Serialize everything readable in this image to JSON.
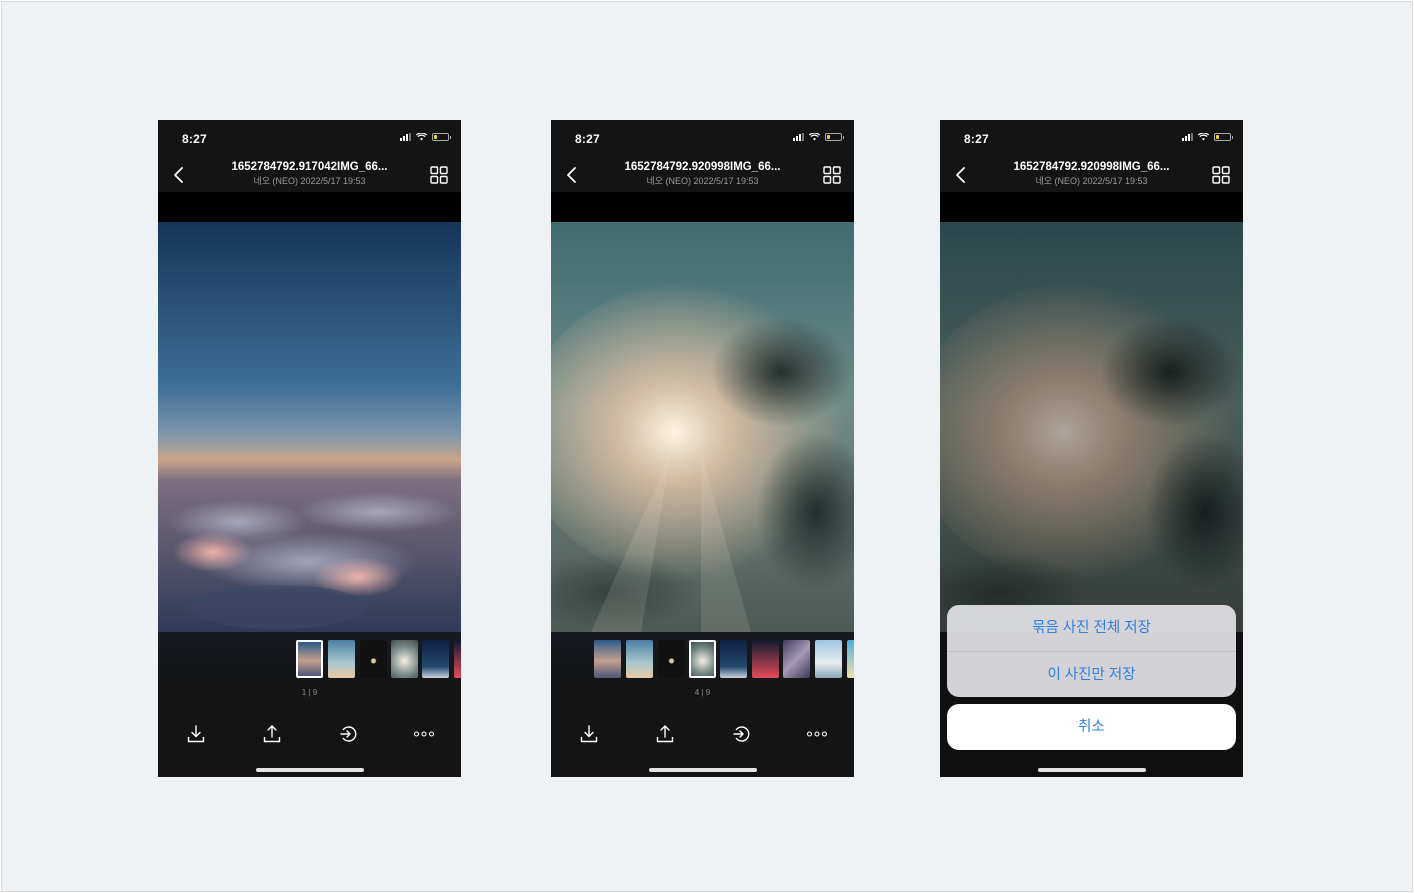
{
  "screens": [
    {
      "id": "screen-1",
      "status_time": "8:27",
      "battery_level": 0.2,
      "title": "1652784792.917042IMG_66...",
      "subtitle": "네오 (NEO) 2022/5/17 19:53",
      "photo_scene": "sunset-above-clouds",
      "thumbnails_count_visible": 6,
      "selected_index": 0,
      "counter": "1 | 9",
      "toolbar": [
        "download-icon",
        "share-icon",
        "forward-icon",
        "more-icon"
      ]
    },
    {
      "id": "screen-2",
      "status_time": "8:27",
      "battery_level": 0.2,
      "title": "1652784792.920998IMG_66...",
      "subtitle": "네오 (NEO) 2022/5/17 19:53",
      "photo_scene": "sun-rays-through-clouds",
      "thumbnails_count_visible": 9,
      "selected_index": 3,
      "counter": "4 | 9",
      "toolbar": [
        "download-icon",
        "share-icon",
        "forward-icon",
        "more-icon"
      ]
    },
    {
      "id": "screen-3",
      "status_time": "8:27",
      "battery_level": 0.2,
      "title": "1652784792.920998IMG_66...",
      "subtitle": "네오 (NEO) 2022/5/17 19:53",
      "photo_scene": "sun-rays-through-clouds-dimmed",
      "action_sheet": {
        "options": [
          "묶음 사진 전체 저장",
          "이 사진만 저장"
        ],
        "cancel": "취소"
      }
    }
  ],
  "colors": {
    "background": "#eff2f5",
    "phone_bg": "#141414",
    "accent_blue": "#2f7fe0",
    "battery": "#f5d230"
  }
}
